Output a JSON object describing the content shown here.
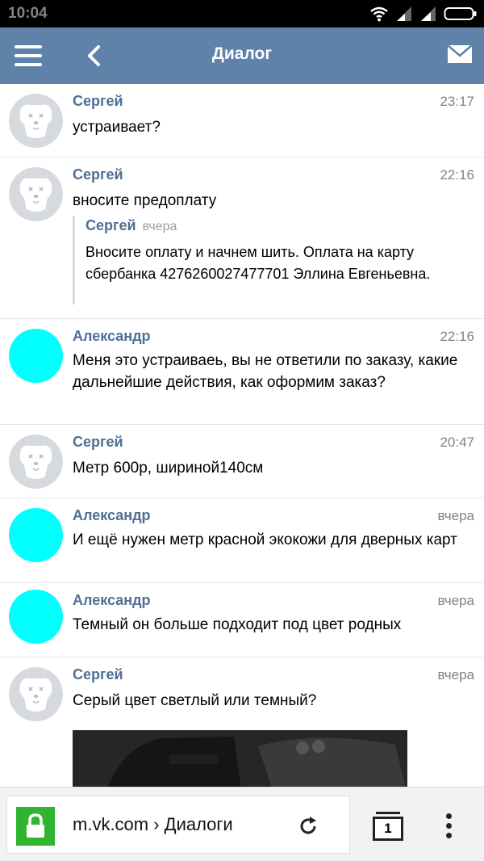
{
  "status_bar": {
    "time": "10:04"
  },
  "header": {
    "title": "Диалог",
    "menu_icon": "hamburger-icon",
    "back_icon": "chevron-left-icon",
    "mail_icon": "mail-icon"
  },
  "messages": [
    {
      "author": "Сергей",
      "time": "23:17",
      "text": "устраивает?",
      "avatar": "dog-avatar"
    },
    {
      "author": "Сергей",
      "time": "22:16",
      "text": "вносите предоплату",
      "avatar": "dog-avatar",
      "quote": {
        "author": "Сергей",
        "time": "вчера",
        "text": "Вносите оплату и начнем шить. Оплата на карту сбербанка 4276260027477701 Эллина Евгеньевна."
      }
    },
    {
      "author": "Александр",
      "time": "22:16",
      "text": "Меня это устраиваеь, вы не ответили по заказу, какие дальнейшие действия, как оформим заказ?",
      "avatar": "redacted-avatar"
    },
    {
      "author": "Сергей",
      "time": "20:47",
      "text": "Метр 600р, шириной140см",
      "avatar": "dog-avatar"
    },
    {
      "author": "Александр",
      "time": "вчера",
      "text": "И ещё нужен метр красной экокожи для дверных карт",
      "avatar": "redacted-avatar"
    },
    {
      "author": "Александр",
      "time": "вчера",
      "text": "Темный он больше подходит под цвет родных",
      "avatar": "redacted-avatar"
    },
    {
      "author": "Сергей",
      "time": "вчера",
      "text": "Серый цвет светлый или темный?",
      "avatar": "dog-avatar"
    }
  ],
  "browser": {
    "url": "m.vk.com › Диалоги",
    "tab_count": "1"
  },
  "colors": {
    "header": "#5e82a8",
    "author": "#4f6f94",
    "lock": "#2fb52f",
    "redaction": "#00ffff"
  }
}
